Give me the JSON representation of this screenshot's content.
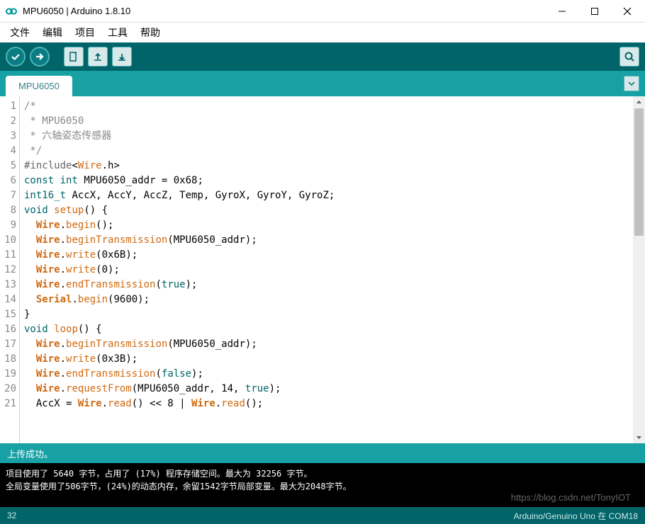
{
  "window": {
    "title": "MPU6050 | Arduino 1.8.10"
  },
  "menu": {
    "file": "文件",
    "edit": "编辑",
    "sketch": "项目",
    "tools": "工具",
    "help": "帮助"
  },
  "tab": {
    "name": "MPU6050"
  },
  "code": {
    "lines": [
      "1",
      "2",
      "3",
      "4",
      "5",
      "6",
      "7",
      "8",
      "9",
      "10",
      "11",
      "12",
      "13",
      "14",
      "15",
      "16",
      "17",
      "18",
      "19",
      "20",
      "21"
    ],
    "l1": "/*",
    "l2": " * MPU6050",
    "l3": " * 六轴姿态传感器",
    "l4": " */",
    "l5a": "#include",
    "l5b": "<",
    "l5c": "Wire",
    "l5d": ".h>",
    "l6a": "const",
    "l6b": "int",
    "l6c": " MPU6050_addr = 0x68;",
    "l7a": "int16_t",
    "l7b": " AccX, AccY, AccZ, Temp, GyroX, GyroY, GyroZ;",
    "l8a": "void",
    "l8b": "setup",
    "l8c": "() {",
    "l9a": "Wire",
    "l9b": ".",
    "l9c": "begin",
    "l9d": "();",
    "l10a": "Wire",
    "l10b": ".",
    "l10c": "beginTransmission",
    "l10d": "(MPU6050_addr);",
    "l11a": "Wire",
    "l11b": ".",
    "l11c": "write",
    "l11d": "(0x6B);",
    "l12a": "Wire",
    "l12b": ".",
    "l12c": "write",
    "l12d": "(0);",
    "l13a": "Wire",
    "l13b": ".",
    "l13c": "endTransmission",
    "l13d": "(",
    "l13e": "true",
    "l13f": ");",
    "l14a": "Serial",
    "l14b": ".",
    "l14c": "begin",
    "l14d": "(9600);",
    "l15": "}",
    "l16a": "void",
    "l16b": "loop",
    "l16c": "() {",
    "l17a": "Wire",
    "l17b": ".",
    "l17c": "beginTransmission",
    "l17d": "(MPU6050_addr);",
    "l18a": "Wire",
    "l18b": ".",
    "l18c": "write",
    "l18d": "(0x3B);",
    "l19a": "Wire",
    "l19b": ".",
    "l19c": "endTransmission",
    "l19d": "(",
    "l19e": "false",
    "l19f": ");",
    "l20a": "Wire",
    "l20b": ".",
    "l20c": "requestFrom",
    "l20d": "(MPU6050_addr, 14, ",
    "l20e": "true",
    "l20f": ");",
    "l21a": "  AccX = ",
    "l21b": "Wire",
    "l21c": ".",
    "l21d": "read",
    "l21e": "() << 8 | ",
    "l21f": "Wire",
    "l21g": ".",
    "l21h": "read",
    "l21i": "();"
  },
  "status": {
    "message": "上传成功。"
  },
  "console": {
    "line1": "项目使用了 5640 字节，占用了 (17%) 程序存储空间。最大为 32256 字节。",
    "line2": "全局变量使用了506字节，(24%)的动态内存，余留1542字节局部变量。最大为2048字节。"
  },
  "footer": {
    "left": "32",
    "right": "Arduino/Genuino Uno 在 COM18"
  },
  "watermark": "https://blog.csdn.net/TonyIOT"
}
